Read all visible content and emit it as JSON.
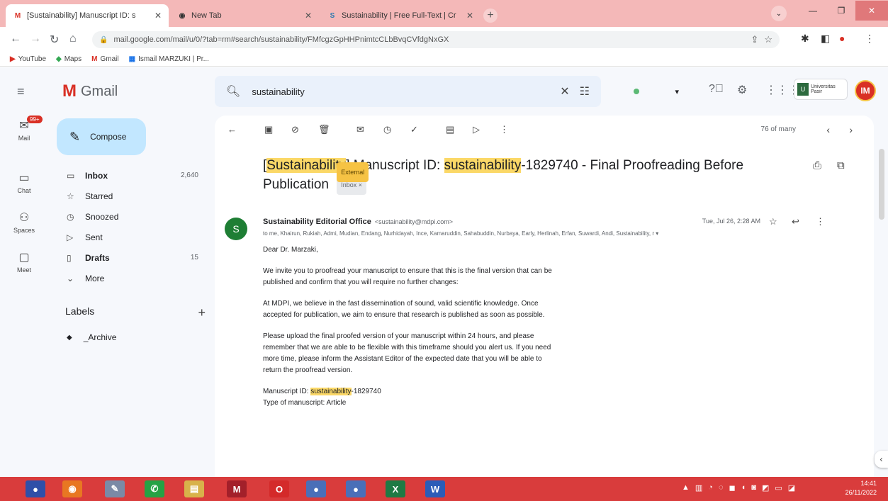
{
  "browser": {
    "tabs": [
      {
        "title": "[Sustainability] Manuscript ID: s",
        "favicon": "M",
        "active": true
      },
      {
        "title": "New Tab",
        "favicon": "◉",
        "active": false
      },
      {
        "title": "Sustainability | Free Full-Text | Cr",
        "favicon": "S",
        "active": false
      }
    ],
    "url": "mail.google.com/mail/u/0/?tab=rm#search/sustainability/FMfcgzGpHHPnimtcCLbBvqCVfdgNxGX",
    "bookmarks": [
      {
        "label": "YouTube",
        "icon": "▶"
      },
      {
        "label": "Maps",
        "icon": "◆"
      },
      {
        "label": "Gmail",
        "icon": "M"
      },
      {
        "label": "Ismail MARZUKI | Pr...",
        "icon": "▦"
      }
    ]
  },
  "gmail": {
    "app_name": "Gmail",
    "search_query": "sustainability",
    "org_badge": "Universitas Pasir",
    "avatar_initial": "IM",
    "rail": [
      {
        "label": "Mail",
        "badge": "99+"
      },
      {
        "label": "Chat"
      },
      {
        "label": "Spaces"
      },
      {
        "label": "Meet"
      }
    ],
    "compose_label": "Compose",
    "nav": [
      {
        "label": "Inbox",
        "count": "2,640",
        "bold": true,
        "icon": "▭"
      },
      {
        "label": "Starred",
        "count": "",
        "bold": false,
        "icon": "☆"
      },
      {
        "label": "Snoozed",
        "count": "",
        "bold": false,
        "icon": "◷"
      },
      {
        "label": "Sent",
        "count": "",
        "bold": false,
        "icon": "▷"
      },
      {
        "label": "Drafts",
        "count": "15",
        "bold": true,
        "icon": "▯"
      },
      {
        "label": "More",
        "count": "",
        "bold": false,
        "icon": "⌄"
      }
    ],
    "labels_header": "Labels",
    "labels": [
      {
        "label": "_Archive"
      }
    ],
    "paging": "76 of many",
    "email": {
      "subject_parts": [
        "[",
        "Sustainability",
        "] Manuscript ID: ",
        "sustainability",
        "-1829740 - Final Proofreading Before Publication"
      ],
      "chip_external": "External",
      "chip_inbox": "Inbox ×",
      "sender_initial": "S",
      "sender_name": "Sustainability Editorial Office",
      "sender_email": "<sustainability@mdpi.com>",
      "recipients": "to me, Khairun, Rukiah, Admi, Mudian, Endang, Nurhidayah, Ince, Kamaruddin, Sahabuddin, Nurbaya, Early, Herlinah, Erfan, Suwardi, Andi, Sustainability, r ▾",
      "date": "Tue, Jul 26, 2:28 AM",
      "greeting": "Dear Dr. Marzaki,",
      "paragraphs": [
        "We invite you to proofread your manuscript to ensure that this is the final version that can be published and confirm that you will require no further changes:",
        "At MDPI, we believe in the fast dissemination of sound, valid scientific knowledge. Once accepted for publication, we aim to ensure that research is published as soon as possible.",
        "Please upload the final proofed version of your manuscript within 24 hours, and please remember that we are able to be flexible with this timeframe should you alert us. If you need more time, please inform the Assistant Editor of the expected date that you will be able to return the proofread version."
      ],
      "ms_id_label": "Manuscript ID:",
      "ms_id_hl": "sustainability",
      "ms_id_rest": "-1829740",
      "ms_type": "Type of manuscript: Article"
    }
  },
  "taskbar": {
    "time": "14:41",
    "date": "26/11/2022",
    "apps": [
      "Chrome",
      "Firefox",
      "Paint",
      "WhatsApp",
      "Explorer",
      "Mendeley",
      "Opera",
      "Chrome",
      "Chrome",
      "Excel",
      "Word"
    ]
  },
  "colors": {
    "tab_strip": "#f4b8b8",
    "taskbar": "#d93c3c",
    "highlight": "#fbd867",
    "compose": "#c2e7ff",
    "sender_avatar": "#1e7e34"
  }
}
